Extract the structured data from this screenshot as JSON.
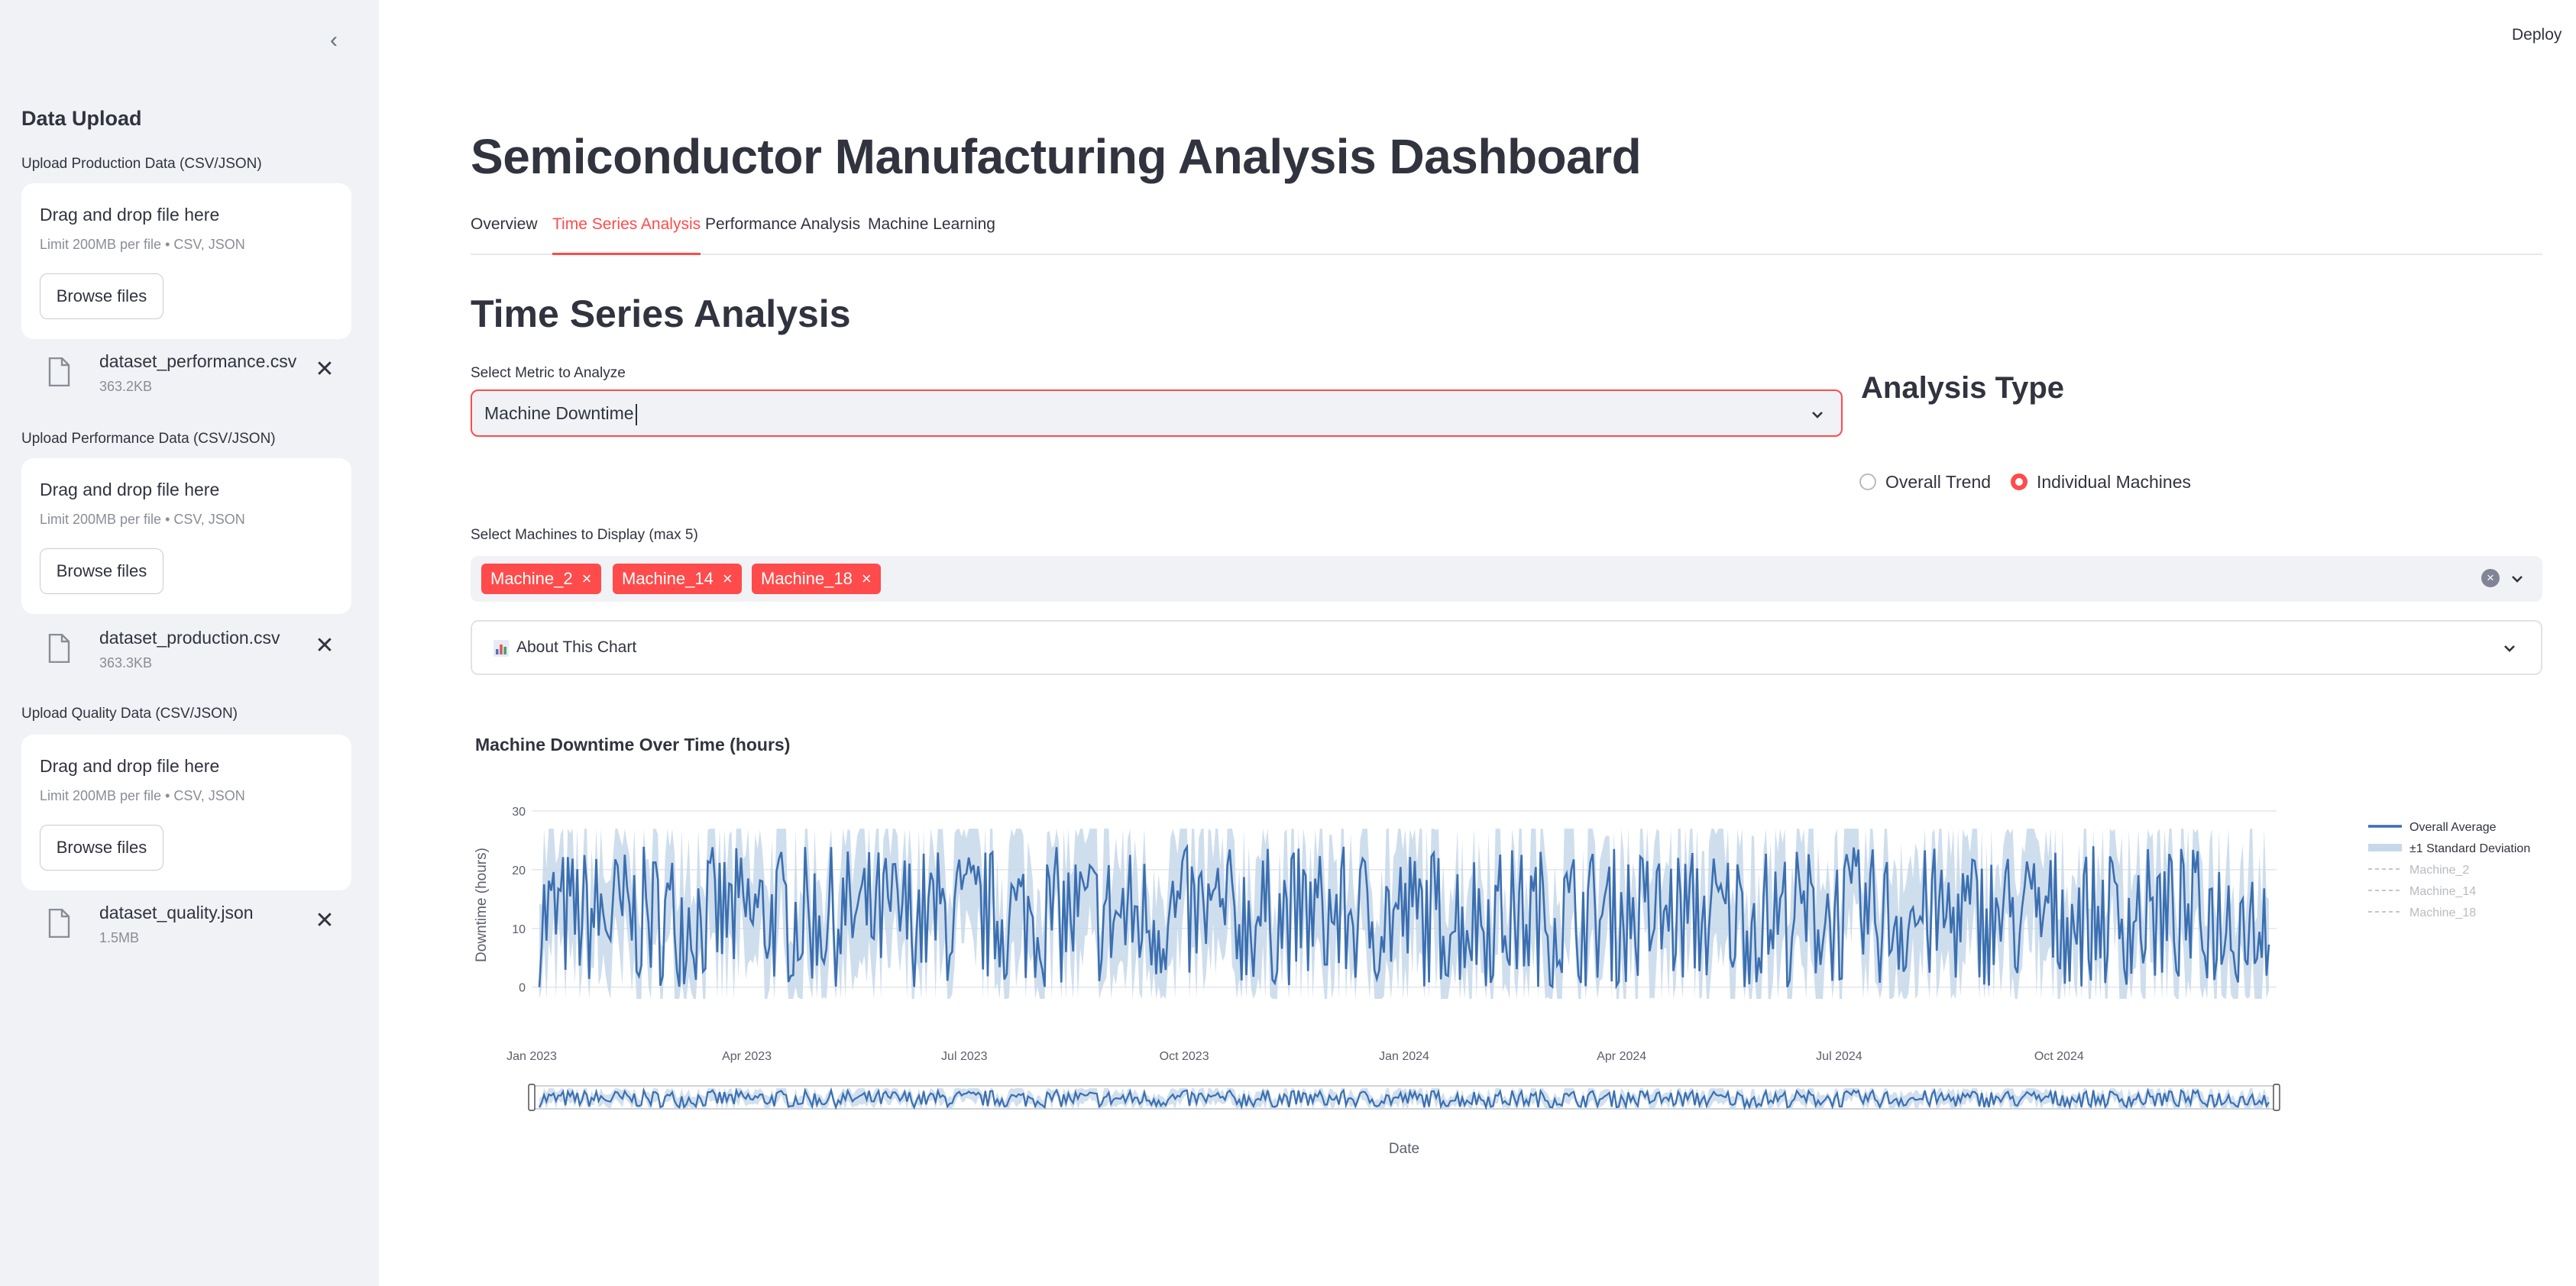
{
  "header": {
    "deploy_label": "Deploy"
  },
  "sidebar": {
    "title": "Data Upload",
    "uploads": [
      {
        "label": "Upload Production Data (CSV/JSON)",
        "dropzone_title": "Drag and drop file here",
        "limit_text": "Limit 200MB per file • CSV, JSON",
        "browse_label": "Browse files",
        "file": {
          "name": "dataset_performance.csv",
          "size": "363.2KB"
        }
      },
      {
        "label": "Upload Performance Data (CSV/JSON)",
        "dropzone_title": "Drag and drop file here",
        "limit_text": "Limit 200MB per file • CSV, JSON",
        "browse_label": "Browse files",
        "file": {
          "name": "dataset_production.csv",
          "size": "363.3KB"
        }
      },
      {
        "label": "Upload Quality Data (CSV/JSON)",
        "dropzone_title": "Drag and drop file here",
        "limit_text": "Limit 200MB per file • CSV, JSON",
        "browse_label": "Browse files",
        "file": {
          "name": "dataset_quality.json",
          "size": "1.5MB"
        }
      }
    ],
    "icons": {
      "collapse": "chevron-left-icon",
      "file": "file-icon",
      "remove": "close-icon"
    }
  },
  "main": {
    "title": "Semiconductor Manufacturing Analysis Dashboard",
    "tabs": [
      {
        "label": "Overview",
        "active": false
      },
      {
        "label": "Time Series Analysis",
        "active": true
      },
      {
        "label": "Performance Analysis",
        "active": false
      },
      {
        "label": "Machine Learning",
        "active": false
      }
    ],
    "section_title": "Time Series Analysis",
    "metric_select": {
      "label": "Select Metric to Analyze",
      "value": "Machine Downtime"
    },
    "analysis_type": {
      "title": "Analysis Type",
      "options": [
        {
          "label": "Overall Trend",
          "selected": false
        },
        {
          "label": "Individual Machines",
          "selected": true
        }
      ]
    },
    "machines_select": {
      "label": "Select Machines to Display (max 5)",
      "selected": [
        "Machine_2",
        "Machine_14",
        "Machine_18"
      ]
    },
    "expander": {
      "label": "About This Chart",
      "icon": "bar-chart-icon"
    },
    "accent_color": "#ff4b4b"
  },
  "chart_data": {
    "type": "line",
    "title": "Machine Downtime Over Time (hours)",
    "xlabel": "Date",
    "ylabel": "Downtime (hours)",
    "x_ticks": [
      "Jan 2023",
      "Apr 2023",
      "Jul 2023",
      "Oct 2023",
      "Jan 2024",
      "Apr 2024",
      "Jul 2024",
      "Oct 2024"
    ],
    "x_range": [
      "2023-01-01",
      "2024-12-31"
    ],
    "y_ticks": [
      0,
      10,
      20,
      30
    ],
    "ylim": [
      -2,
      30
    ],
    "grid": true,
    "legend_position": "right",
    "range_slider": true,
    "series": [
      {
        "name": "Overall Average",
        "color": "#3b6fb0",
        "style": "solid",
        "approx_mean": 12,
        "approx_min": 0,
        "approx_max": 24
      },
      {
        "name": "±1 Standard Deviation",
        "color": "#c7d8ea",
        "style": "band",
        "approx_lower": -2,
        "approx_upper": 27
      },
      {
        "name": "Machine_2",
        "color": "#c5c7cc",
        "style": "dashed",
        "visible": false
      },
      {
        "name": "Machine_14",
        "color": "#c5c7cc",
        "style": "dashed",
        "visible": false
      },
      {
        "name": "Machine_18",
        "color": "#c5c7cc",
        "style": "dashed",
        "visible": false
      }
    ]
  }
}
